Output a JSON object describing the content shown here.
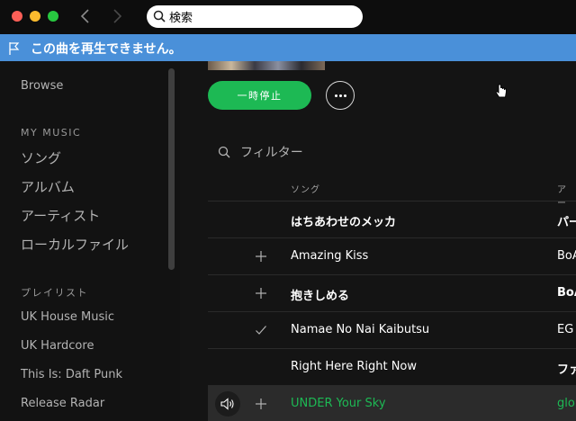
{
  "search": {
    "value": "検索"
  },
  "banner": {
    "message": "この曲を再生できません。"
  },
  "sidebar": {
    "browse": "Browse",
    "my_music_header": "MY MUSIC",
    "my_music": [
      "ソング",
      "アルバム",
      "アーティスト",
      "ローカルファイル"
    ],
    "playlists_header": "プレイリスト",
    "playlists": [
      "UK House Music",
      "UK Hardcore",
      "This Is: Daft Punk",
      "Release Radar"
    ]
  },
  "main": {
    "play_label": "一時停止",
    "filter_label": "フィルター",
    "columns": {
      "song": "ソング",
      "artist": "アー"
    },
    "tracks": [
      {
        "title": "はちあわせのメッカ",
        "artist": "パー",
        "mark": "none"
      },
      {
        "title": "Amazing Kiss",
        "artist": "BoA",
        "mark": "plus"
      },
      {
        "title": "抱きしめる",
        "artist": "BoA",
        "mark": "plus"
      },
      {
        "title": "Namae No Nai Kaibutsu",
        "artist": "EG",
        "mark": "check"
      },
      {
        "title": "Right Here Right Now",
        "artist": "ファ",
        "mark": "none"
      },
      {
        "title": "UNDER Your Sky",
        "artist": "glo",
        "mark": "plus",
        "playing": true
      }
    ]
  },
  "colors": {
    "accent": "#1db954",
    "banner": "#4a90d9",
    "background": "#121212"
  }
}
